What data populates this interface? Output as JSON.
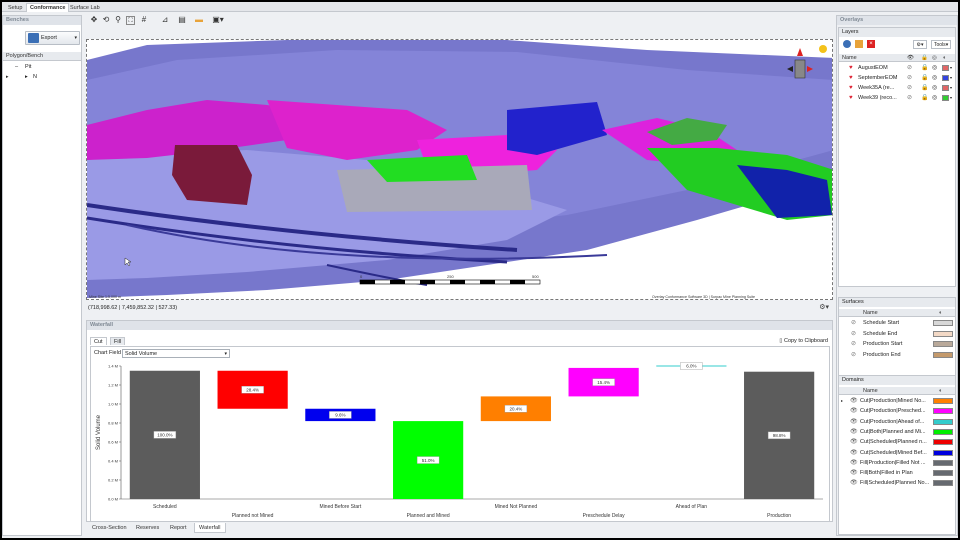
{
  "top_tabs": [
    "Setup",
    "Conformance",
    "Surface Lab"
  ],
  "benches": {
    "title": "Benches",
    "export_label": "Export",
    "column_header": "Polygon/Bench",
    "tree": [
      {
        "label": "Pit",
        "expand": "–"
      },
      {
        "label": "N",
        "expand": "▸"
      }
    ]
  },
  "viewport": {
    "coordinates": "(718,998.62 | 7,459,852.32 | 527.33)",
    "scale_labels": [
      "0",
      "250",
      "500"
    ],
    "bottom_left_text": "Mine Site 1:5,000 m",
    "attribution": "Overlay Conformance Software 3D | Surpac Mine Planning Suite"
  },
  "waterfall": {
    "title": "Waterfall",
    "tabs": [
      "Cut",
      "Fill"
    ],
    "chart_field_label": "Chart Field",
    "chart_field_value": "Solid Volume",
    "copy_label": "Copy to Clipboard",
    "bottom_tabs": [
      "Cross-Section",
      "Reserves",
      "Report",
      "Waterfall"
    ]
  },
  "chart_data": {
    "type": "bar",
    "subtype": "waterfall",
    "ylabel": "Solid Volume",
    "ylim": [
      0,
      1.4
    ],
    "yticks": [
      "0.0 M",
      "0.2 M",
      "0.4 M",
      "0.6 M",
      "0.8 M",
      "1.0 M",
      "1.2 M",
      "1.4 M"
    ],
    "categories": [
      "Scheduled",
      "Planned not Mined",
      "Mined Before Start",
      "Planned and Mined",
      "Mined Not Planned",
      "Preschedule Delay",
      "Ahead of Plan",
      "Production"
    ],
    "bars": [
      {
        "bottom": 0.0,
        "top": 1.35,
        "label": "100.0%",
        "color": "#5c5c5c"
      },
      {
        "bottom": 0.95,
        "top": 1.35,
        "label": "28.4%",
        "color": "#ff0000"
      },
      {
        "bottom": 0.82,
        "top": 0.95,
        "label": "9.6%",
        "color": "#0000ee"
      },
      {
        "bottom": 0.0,
        "top": 0.82,
        "label": "51.0%",
        "color": "#00ff00"
      },
      {
        "bottom": 0.82,
        "top": 1.08,
        "label": "20.4%",
        "color": "#ff7f00"
      },
      {
        "bottom": 1.08,
        "top": 1.38,
        "label": "15.4%",
        "color": "#ff00ff"
      },
      {
        "bottom": 1.37,
        "top": 1.4,
        "label": "6.0%",
        "color": "#33cccc"
      },
      {
        "bottom": 0.0,
        "top": 1.34,
        "label": "98.8%",
        "color": "#5c5c5c"
      }
    ],
    "grid": false,
    "legend": "none"
  },
  "overlays": {
    "title": "Overlays",
    "layers_title": "Layers",
    "tools_label": "Tools",
    "column_name": "Name",
    "layers": [
      {
        "name": "AugustEOM",
        "color": "#e06666"
      },
      {
        "name": "SeptemberEOM",
        "color": "#3344dd"
      },
      {
        "name": "Week35A (re...",
        "color": "#e06666"
      },
      {
        "name": "Week39 (reco...",
        "color": "#33cc33"
      }
    ]
  },
  "surfaces": {
    "title": "Surfaces",
    "column_name": "Name",
    "items": [
      {
        "name": "Schedule Start",
        "color": "#d8d8d8"
      },
      {
        "name": "Schedule End",
        "color": "#f3d9c6"
      },
      {
        "name": "Production Start",
        "color": "#b9a99a"
      },
      {
        "name": "Production End",
        "color": "#c49a6c"
      }
    ]
  },
  "domains": {
    "title": "Domains",
    "column_name": "Name",
    "items": [
      {
        "name": "Cut|Production|Mined No...",
        "color": "#ff8000"
      },
      {
        "name": "Cut|Production|Presched...",
        "color": "#ff00ff"
      },
      {
        "name": "Cut|Production|Ahead of...",
        "color": "#33cccc"
      },
      {
        "name": "Cut|Both|Planned and Mi...",
        "color": "#00ee00"
      },
      {
        "name": "Cut|Scheduled|Planned n...",
        "color": "#ee0000"
      },
      {
        "name": "Cut|Scheduled|Mined Bef...",
        "color": "#0000dd"
      },
      {
        "name": "Fill|Production|Filled Not ...",
        "color": "#666a70"
      },
      {
        "name": "Fill|Both|Filled in Plan",
        "color": "#666a70"
      },
      {
        "name": "Fill|Scheduled|Planned No...",
        "color": "#666a70"
      }
    ]
  }
}
